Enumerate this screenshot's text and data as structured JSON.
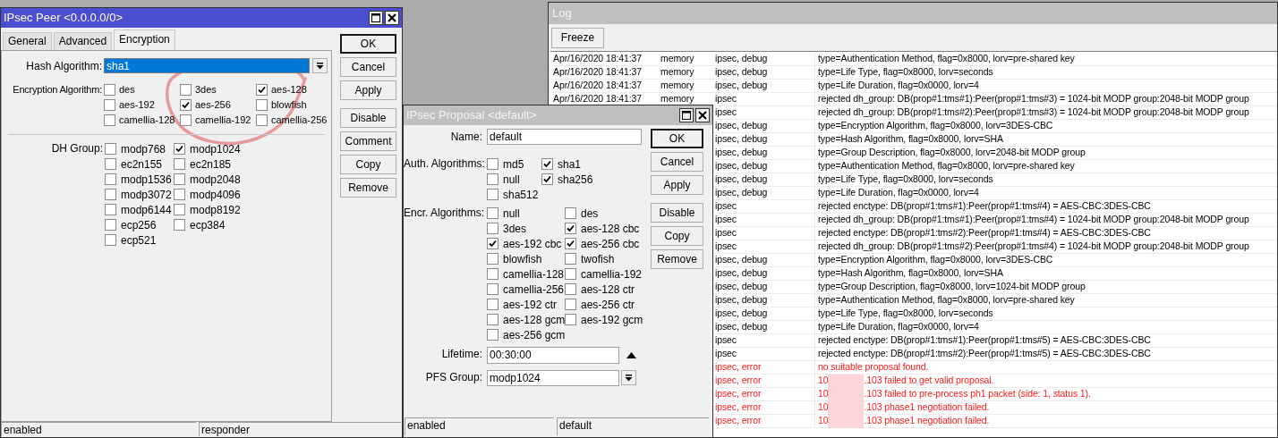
{
  "peer_window": {
    "title": "IPsec Peer <0.0.0.0/0>",
    "tabs": [
      {
        "label": "General",
        "selected": false
      },
      {
        "label": "Advanced",
        "selected": false
      },
      {
        "label": "Encryption",
        "selected": true
      }
    ],
    "hash_algorithm": {
      "label": "Hash Algorithm:",
      "value": "sha1"
    },
    "encryption_algorithm": {
      "label": "Encryption Algorithm:",
      "options": [
        {
          "label": "des",
          "checked": false
        },
        {
          "label": "3des",
          "checked": false
        },
        {
          "label": "aes-128",
          "checked": true
        },
        {
          "label": "aes-192",
          "checked": false
        },
        {
          "label": "aes-256",
          "checked": true
        },
        {
          "label": "blowfish",
          "checked": false
        },
        {
          "label": "camellia-128",
          "checked": false
        },
        {
          "label": "camellia-192",
          "checked": false
        },
        {
          "label": "camellia-256",
          "checked": false
        }
      ]
    },
    "dh_group": {
      "label": "DH Group:",
      "options": [
        {
          "label": "modp768",
          "checked": false
        },
        {
          "label": "modp1024",
          "checked": true
        },
        {
          "label": "ec2n155",
          "checked": false
        },
        {
          "label": "ec2n185",
          "checked": false
        },
        {
          "label": "modp1536",
          "checked": false
        },
        {
          "label": "modp2048",
          "checked": false
        },
        {
          "label": "modp3072",
          "checked": false
        },
        {
          "label": "modp4096",
          "checked": false
        },
        {
          "label": "modp6144",
          "checked": false
        },
        {
          "label": "modp8192",
          "checked": false
        },
        {
          "label": "ecp256",
          "checked": false
        },
        {
          "label": "ecp384",
          "checked": false
        },
        {
          "label": "ecp521",
          "checked": false
        }
      ]
    },
    "buttons": [
      {
        "label": "OK",
        "default": true
      },
      {
        "label": "Cancel",
        "default": false
      },
      {
        "label": "Apply",
        "default": false
      },
      {
        "label": "Disable",
        "default": false
      },
      {
        "label": "Comment",
        "default": false
      },
      {
        "label": "Copy",
        "default": false
      },
      {
        "label": "Remove",
        "default": false
      }
    ],
    "status_bar": [
      "enabled",
      "responder"
    ]
  },
  "proposal_window": {
    "title": "IPsec Proposal <default>",
    "name": {
      "label": "Name:",
      "value": "default"
    },
    "auth_algorithms": {
      "label": "Auth. Algorithms:",
      "options": [
        {
          "label": "md5",
          "checked": false
        },
        {
          "label": "sha1",
          "checked": true
        },
        {
          "label": "null",
          "checked": false
        },
        {
          "label": "sha256",
          "checked": true
        },
        {
          "label": "sha512",
          "checked": false
        }
      ]
    },
    "encr_algorithms": {
      "label": "Encr. Algorithms:",
      "options": [
        {
          "label": "null",
          "checked": false
        },
        {
          "label": "des",
          "checked": false
        },
        {
          "label": "3des",
          "checked": false
        },
        {
          "label": "aes-128 cbc",
          "checked": true
        },
        {
          "label": "aes-192 cbc",
          "checked": true
        },
        {
          "label": "aes-256 cbc",
          "checked": true
        },
        {
          "label": "blowfish",
          "checked": false
        },
        {
          "label": "twofish",
          "checked": false
        },
        {
          "label": "camellia-128",
          "checked": false
        },
        {
          "label": "camellia-192",
          "checked": false
        },
        {
          "label": "camellia-256",
          "checked": false
        },
        {
          "label": "aes-128 ctr",
          "checked": false
        },
        {
          "label": "aes-192 ctr",
          "checked": false
        },
        {
          "label": "aes-256 ctr",
          "checked": false
        },
        {
          "label": "aes-128 gcm",
          "checked": false
        },
        {
          "label": "aes-192 gcm",
          "checked": false
        },
        {
          "label": "aes-256 gcm",
          "checked": false
        }
      ]
    },
    "lifetime": {
      "label": "Lifetime:",
      "value": "00:30:00"
    },
    "pfs_group": {
      "label": "PFS Group:",
      "value": "modp1024"
    },
    "buttons": [
      {
        "label": "OK",
        "default": true
      },
      {
        "label": "Cancel",
        "default": false
      },
      {
        "label": "Apply",
        "default": false
      },
      {
        "label": "Disable",
        "default": false
      },
      {
        "label": "Copy",
        "default": false
      },
      {
        "label": "Remove",
        "default": false
      }
    ],
    "status_bar": [
      "enabled",
      "default"
    ]
  },
  "log_window": {
    "title": "Log",
    "freeze_button": "Freeze",
    "rows": [
      {
        "time": "Apr/16/2020 18:41:37",
        "buffer": "memory",
        "topics": "ipsec, debug",
        "message": "type=Authentication Method, flag=0x8000, lorv=pre-shared key",
        "kind": "info"
      },
      {
        "time": "Apr/16/2020 18:41:37",
        "buffer": "memory",
        "topics": "ipsec, debug",
        "message": "type=Life Type, flag=0x8000, lorv=seconds",
        "kind": "info"
      },
      {
        "time": "Apr/16/2020 18:41:37",
        "buffer": "memory",
        "topics": "ipsec, debug",
        "message": "type=Life Duration, flag=0x0000, lorv=4",
        "kind": "info"
      },
      {
        "time": "Apr/16/2020 18:41:37",
        "buffer": "memory",
        "topics": "ipsec",
        "message": "rejected dh_group: DB(prop#1:tms#1):Peer(prop#1:tms#3) = 1024-bit MODP group:2048-bit MODP group",
        "kind": "info"
      },
      {
        "topics": "ipsec",
        "message": "rejected dh_group: DB(prop#1:tms#2):Peer(prop#1:tms#3) = 1024-bit MODP group:2048-bit MODP group",
        "kind": "info"
      },
      {
        "topics": "ipsec, debug",
        "message": "type=Encryption Algorithm, flag=0x8000, lorv=3DES-CBC",
        "kind": "info"
      },
      {
        "topics": "ipsec, debug",
        "message": "type=Hash Algorithm, flag=0x8000, lorv=SHA",
        "kind": "info"
      },
      {
        "topics": "ipsec, debug",
        "message": "type=Group Description, flag=0x8000, lorv=2048-bit MODP group",
        "kind": "info"
      },
      {
        "topics": "ipsec, debug",
        "message": "type=Authentication Method, flag=0x8000, lorv=pre-shared key",
        "kind": "info"
      },
      {
        "topics": "ipsec, debug",
        "message": "type=Life Type, flag=0x8000, lorv=seconds",
        "kind": "info"
      },
      {
        "topics": "ipsec, debug",
        "message": "type=Life Duration, flag=0x0000, lorv=4",
        "kind": "info"
      },
      {
        "topics": "ipsec",
        "message": "rejected enctype: DB(prop#1:tms#1):Peer(prop#1:tms#4) = AES-CBC:3DES-CBC",
        "kind": "info"
      },
      {
        "topics": "ipsec",
        "message": "rejected dh_group: DB(prop#1:tms#1):Peer(prop#1:tms#4) = 1024-bit MODP group:2048-bit MODP group",
        "kind": "info"
      },
      {
        "topics": "ipsec",
        "message": "rejected enctype: DB(prop#1:tms#2):Peer(prop#1:tms#4) = AES-CBC:3DES-CBC",
        "kind": "info"
      },
      {
        "topics": "ipsec",
        "message": "rejected dh_group: DB(prop#1:tms#2):Peer(prop#1:tms#4) = 1024-bit MODP group:2048-bit MODP group",
        "kind": "info"
      },
      {
        "topics": "ipsec, debug",
        "message": "type=Encryption Algorithm, flag=0x8000, lorv=3DES-CBC",
        "kind": "info"
      },
      {
        "topics": "ipsec, debug",
        "message": "type=Hash Algorithm, flag=0x8000, lorv=SHA",
        "kind": "info"
      },
      {
        "topics": "ipsec, debug",
        "message": "type=Group Description, flag=0x8000, lorv=1024-bit MODP group",
        "kind": "info"
      },
      {
        "topics": "ipsec, debug",
        "message": "type=Authentication Method, flag=0x8000, lorv=pre-shared key",
        "kind": "info"
      },
      {
        "topics": "ipsec, debug",
        "message": "type=Life Type, flag=0x8000, lorv=seconds",
        "kind": "info"
      },
      {
        "topics": "ipsec, debug",
        "message": "type=Life Duration, flag=0x0000, lorv=4",
        "kind": "info"
      },
      {
        "topics": "ipsec",
        "message": "rejected enctype: DB(prop#1:tms#1):Peer(prop#1:tms#5) = AES-CBC:3DES-CBC",
        "kind": "info"
      },
      {
        "topics": "ipsec",
        "message": "rejected enctype: DB(prop#1:tms#2):Peer(prop#1:tms#5) = AES-CBC:3DES-CBC",
        "kind": "info"
      },
      {
        "topics": "ipsec, error",
        "message": "no suitable proposal found.",
        "kind": "error"
      },
      {
        "topics": "ipsec, error",
        "message_parts": [
          "10",
          ".103 failed to get valid proposal."
        ],
        "kind": "error"
      },
      {
        "topics": "ipsec, error",
        "message_parts": [
          "10",
          ".103 failed to pre-process ph1 packet (side: 1, status 1)."
        ],
        "kind": "error"
      },
      {
        "topics": "ipsec, error",
        "message_parts": [
          "10",
          ".103 phase1 negotiation failed."
        ],
        "kind": "error"
      },
      {
        "topics": "ipsec, error",
        "message_parts": [
          "10",
          ".103 phase1 negotiation failed."
        ],
        "kind": "error"
      }
    ]
  }
}
